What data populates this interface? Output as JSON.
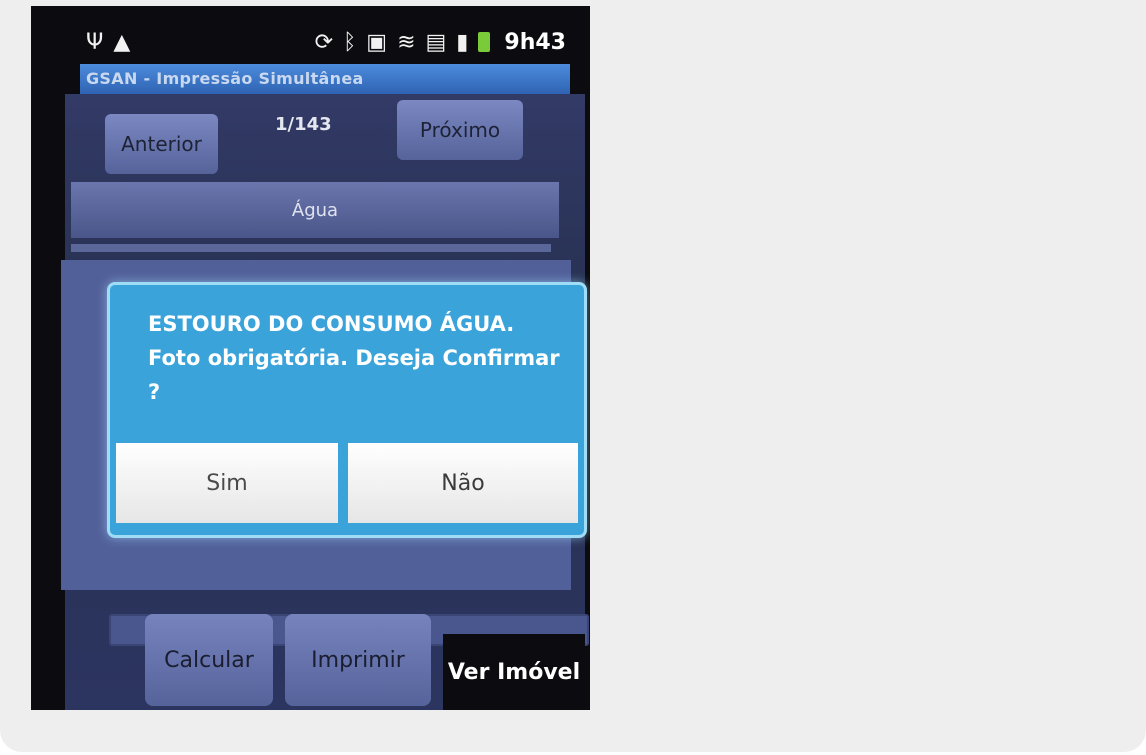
{
  "status_bar": {
    "icons": [
      "usb-icon",
      "warning-icon",
      "sync-icon",
      "bluetooth-icon",
      "vibrate-icon",
      "wifi-icon",
      "sim-icon",
      "signal-icon",
      "battery-icon"
    ],
    "time": "9h43"
  },
  "app": {
    "title": "GSAN - Impressão Simultânea",
    "nav": {
      "previous_label": "Anterior",
      "counter": "1/143",
      "next_label": "Próximo"
    },
    "section_title": "Água"
  },
  "dialog": {
    "message": "ESTOURO DO CONSUMO ÁGUA. Foto obrigatória. Deseja Confirmar ?",
    "yes_label": "Sim",
    "no_label": "Não"
  },
  "bottom_bar": {
    "calcular_label": "Calcular",
    "imprimir_label": "Imprimir",
    "ver_imovel_label": "Ver Imóvel"
  },
  "colors": {
    "dialog_bg": "#3aa3da",
    "title_bar_bg": "#2f63b3",
    "button_bg": "#6a76ad"
  }
}
